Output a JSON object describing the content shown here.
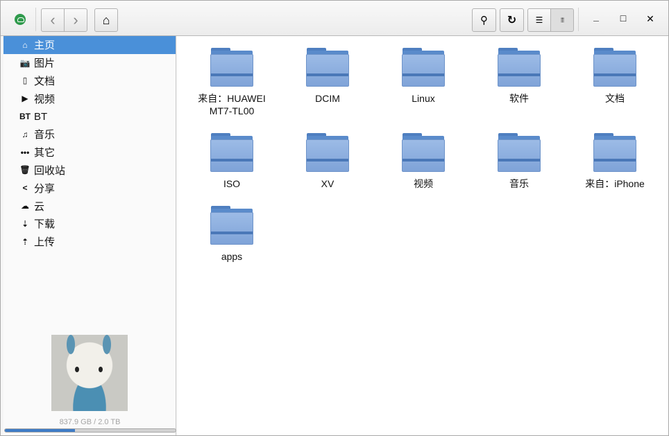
{
  "toolbar": {
    "back": "‹",
    "forward": "›",
    "home": "⌂",
    "search": "⚲",
    "refresh": "↻",
    "list_view": "☰",
    "grid_view": "⁞⁞⁞",
    "minimize": "_",
    "maximize": "□",
    "close": "✕"
  },
  "sidebar": {
    "items": [
      {
        "icon": "⌂",
        "label": "主页"
      },
      {
        "icon": "📷",
        "label": "图片"
      },
      {
        "icon": "▯",
        "label": "文档"
      },
      {
        "icon": "▶",
        "label": "视频"
      },
      {
        "icon": "BT",
        "label": "BT"
      },
      {
        "icon": "♫",
        "label": "音乐"
      },
      {
        "icon": "•••",
        "label": "其它"
      },
      {
        "icon": "🗑",
        "label": "回收站"
      },
      {
        "icon": "<",
        "label": "分享"
      },
      {
        "icon": "☁",
        "label": "云"
      },
      {
        "icon": "⇣",
        "label": "下载"
      },
      {
        "icon": "⇡",
        "label": "上传"
      }
    ],
    "quota_text": "837.9 GB / 2.0 TB",
    "quota_fraction": 0.41
  },
  "folders": [
    "来自：HUAWEI MT7-TL00",
    "DCIM",
    "Linux",
    "软件",
    "文档",
    "ISO",
    "XV",
    "视频",
    "音乐",
    "来自：iPhone",
    "apps"
  ]
}
